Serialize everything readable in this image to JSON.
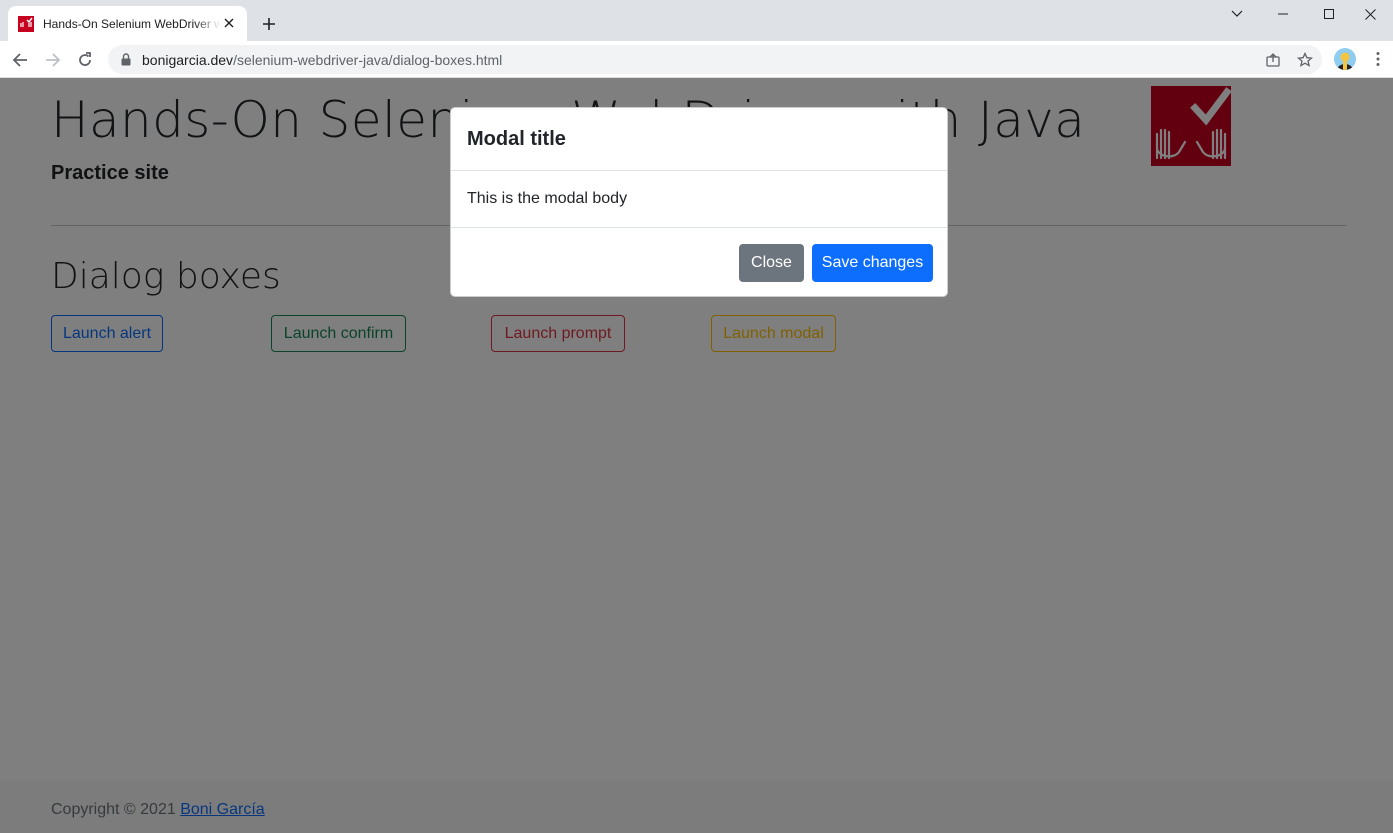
{
  "browser": {
    "tab_title": "Hands-On Selenium WebDriver with Java",
    "url_host": "bonigarcia.dev",
    "url_path": "/selenium-webdriver-java/dialog-boxes.html",
    "icons": [
      "favicon",
      "close-icon",
      "plus-icon",
      "chevron-down-icon",
      "minimize-icon",
      "maximize-icon",
      "close-window-icon",
      "back-arrow-icon",
      "forward-arrow-icon",
      "reload-icon",
      "lock-icon",
      "share-icon",
      "star-icon",
      "avatar",
      "kebab-menu-icon"
    ]
  },
  "page": {
    "title": "Hands-On Selenium WebDriver with Java",
    "subtitle": "Practice site",
    "section_title": "Dialog boxes",
    "buttons": {
      "alert": "Launch alert",
      "confirm": "Launch confirm",
      "prompt": "Launch prompt",
      "modal": "Launch modal"
    },
    "footer": {
      "copyright": "Copyright © 2021",
      "author": "Boni García"
    }
  },
  "modal": {
    "title": "Modal title",
    "body": "This is the modal body",
    "close_label": "Close",
    "save_label": "Save changes"
  },
  "colors": {
    "primary": "#0d6efd",
    "success": "#198754",
    "danger": "#dc3545",
    "warning": "#ffc107",
    "secondary": "#6c757d",
    "logo_red": "#c6011f"
  }
}
